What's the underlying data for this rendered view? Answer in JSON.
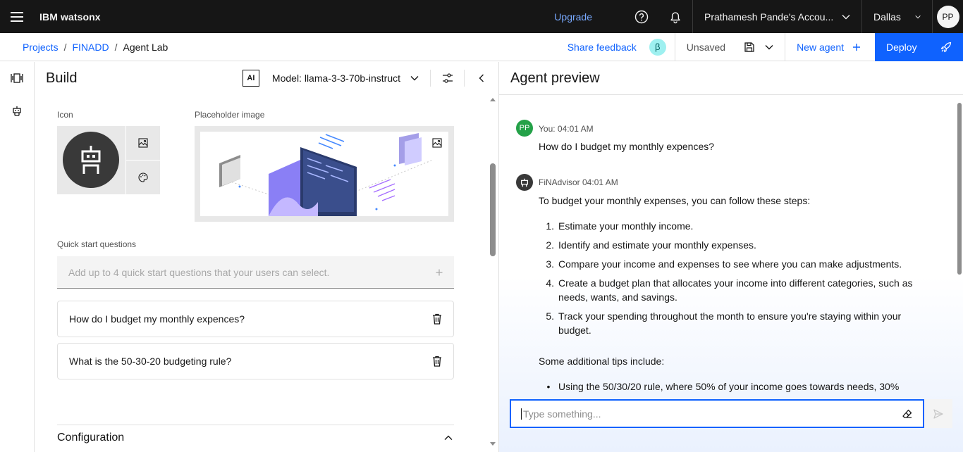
{
  "header": {
    "brand": "IBM watsonx",
    "upgrade": "Upgrade",
    "account": "Prathamesh Pande's Accou...",
    "region": "Dallas",
    "avatar": "PP"
  },
  "subbar": {
    "breadcrumbs": [
      "Projects",
      "FINADD",
      "Agent Lab"
    ],
    "share_feedback": "Share feedback",
    "beta": "β",
    "status": "Unsaved",
    "new_agent": "New agent",
    "deploy": "Deploy"
  },
  "build": {
    "title": "Build",
    "ai_badge": "AI",
    "model": "Model: llama-3-3-70b-instruct",
    "icon_label": "Icon",
    "placeholder_label": "Placeholder image",
    "quick_start_label": "Quick start questions",
    "quick_start_placeholder": "Add up to 4 quick start questions that your users can select.",
    "questions": [
      "How do I budget my monthly expences?",
      "What is the 50-30-20 budgeting rule?"
    ],
    "configuration": "Configuration"
  },
  "preview": {
    "title": "Agent preview",
    "user": {
      "avatar": "PP",
      "meta": "You: 04:01 AM",
      "text": "How do I budget my monthly expences?"
    },
    "agent": {
      "meta": "FiNAdvisor 04:01 AM",
      "intro": "To budget your monthly expenses, you can follow these steps:",
      "steps": [
        "Estimate your monthly income.",
        "Identify and estimate your monthly expenses.",
        "Compare your income and expenses to see where you can make adjustments.",
        "Create a budget plan that allocates your income into different categories, such as needs, wants, and savings.",
        "Track your spending throughout the month to ensure you're staying within your budget."
      ],
      "tips_intro": "Some additional tips include:",
      "tips": [
        "Using the 50/30/20 rule, where 50% of your income goes towards needs, 30%"
      ]
    },
    "composer_placeholder": "Type something..."
  },
  "colors": {
    "accent": "#0f62fe",
    "topbar": "#161616",
    "user_avatar": "#24a148",
    "beta_badge": "#9ef0f0"
  }
}
